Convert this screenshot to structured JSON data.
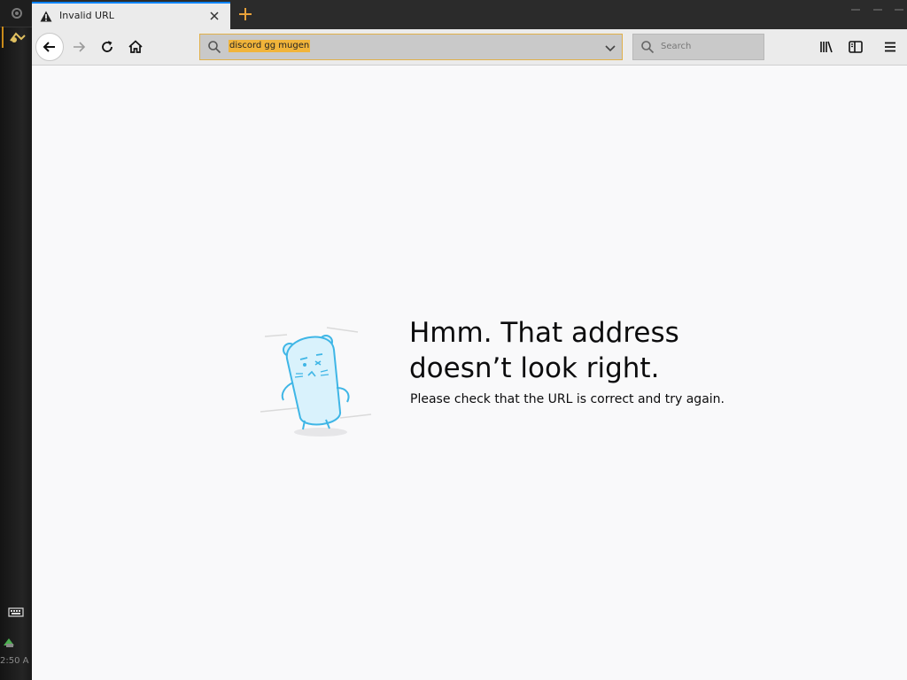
{
  "tab": {
    "title": "Invalid URL",
    "icon": "warning-icon"
  },
  "toolbar": {
    "back": "back-arrow-icon",
    "forward": "forward-arrow-icon",
    "reload": "reload-icon",
    "home": "home-icon"
  },
  "urlbar": {
    "value": "discord gg mugen"
  },
  "search": {
    "placeholder": "Search"
  },
  "error": {
    "title": "Hmm. That address doesn’t look right.",
    "description": "Please check that the URL is correct and try again."
  },
  "dock": {
    "clock": "2:50 A"
  },
  "colors": {
    "accent_tab": "#0a84ff",
    "url_highlight": "#f1b43a",
    "plus": "#e8a23a",
    "illustration": "#5bc3ea"
  }
}
